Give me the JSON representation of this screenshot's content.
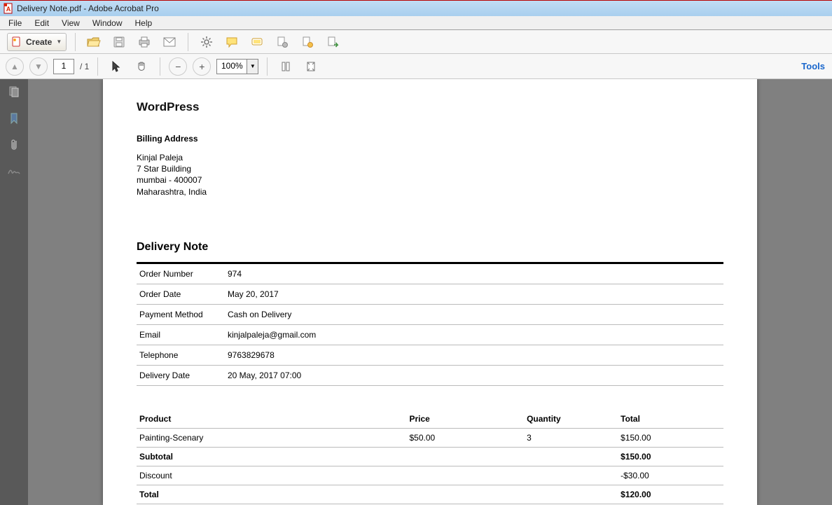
{
  "titlebar": {
    "title": "Delivery Note.pdf - Adobe Acrobat Pro"
  },
  "menu": {
    "file": "File",
    "edit": "Edit",
    "view": "View",
    "window": "Window",
    "help": "Help"
  },
  "toolbar": {
    "create": "Create"
  },
  "nav": {
    "page_current": "1",
    "page_total": "/ 1",
    "zoom": "100%",
    "tools": "Tools"
  },
  "doc": {
    "brand": "WordPress",
    "billing_head": "Billing Address",
    "addr_name": "Kinjal Paleja",
    "addr_l1": "7 Star Building",
    "addr_l2": "mumbai - 400007",
    "addr_l3": "Maharashtra, India",
    "title": "Delivery Note",
    "info": {
      "order_number_label": "Order Number",
      "order_number": "974",
      "order_date_label": "Order Date",
      "order_date": "May 20, 2017",
      "payment_label": "Payment Method",
      "payment": "Cash on Delivery",
      "email_label": "Email",
      "email": "kinjalpaleja@gmail.com",
      "phone_label": "Telephone",
      "phone": "9763829678",
      "delivery_label": "Delivery Date",
      "delivery": "20 May, 2017 07:00"
    },
    "prod_head": {
      "product": "Product",
      "price": "Price",
      "quantity": "Quantity",
      "total": "Total"
    },
    "items": [
      {
        "name": "Painting-Scenary",
        "price": "$50.00",
        "qty": "3",
        "total": "$150.00"
      }
    ],
    "subtotal_label": "Subtotal",
    "subtotal": "$150.00",
    "discount_label": "Discount",
    "discount": "-$30.00",
    "total_label": "Total",
    "total": "$120.00"
  }
}
